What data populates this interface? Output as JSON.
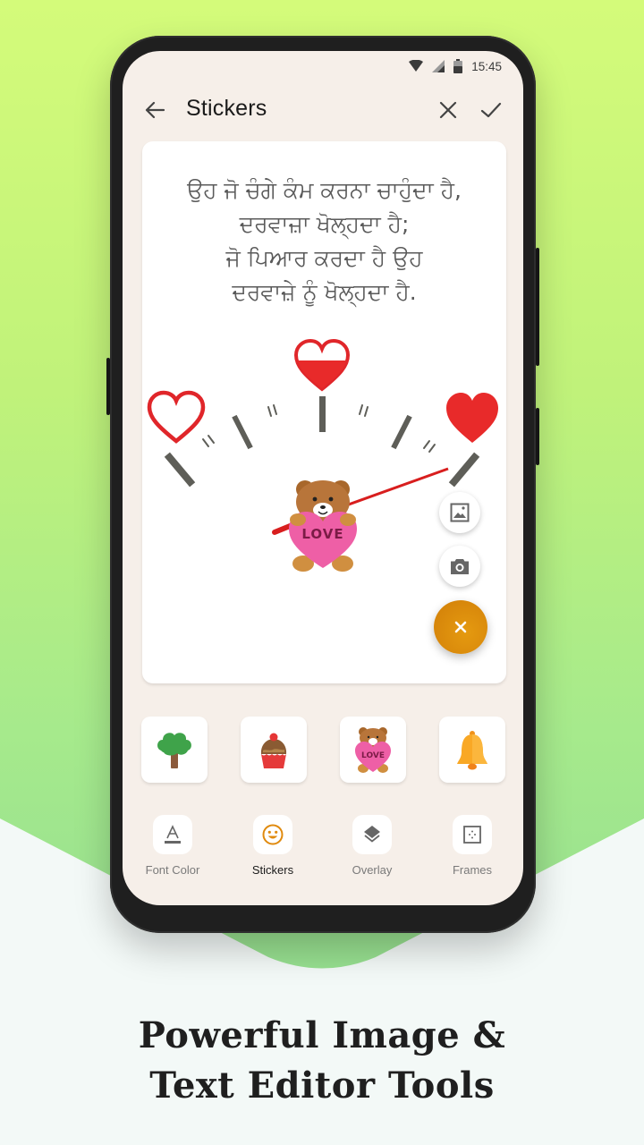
{
  "status_bar": {
    "time": "15:45",
    "icons": [
      "wifi-icon",
      "cell-signal-icon",
      "battery-icon"
    ]
  },
  "app_bar": {
    "title": "Stickers",
    "back_icon": "arrow-left-icon",
    "close_icon": "close-icon",
    "confirm_icon": "check-icon"
  },
  "canvas": {
    "quote_lines": [
      "ਉਹ ਜੋ ਚੰਗੇ ਕੰਮ ਕਰਨਾ ਚਾਹੁੰਦਾ ਹੈ,",
      "ਦਰਵਾਜ਼ਾ ਖੋਲ੍ਹਦਾ ਹੈ;",
      "ਜੋ ਪਿਆਰ ਕਰਦਾ ਹੈ ਉਹ",
      "ਦਰਵਾਜ਼ੇ ਨੂੰ ਖੋਲ੍ਹਦਾ ਹੈ."
    ],
    "gauge": {
      "levels": [
        "empty-heart",
        "half-heart",
        "full-heart"
      ],
      "needle_color": "#d81e1e",
      "heart_color": "#e82a2a"
    },
    "placed_sticker": {
      "name": "teddy-bear-love",
      "text": "LOVE"
    },
    "fab": {
      "gallery_icon": "image-icon",
      "camera_icon": "camera-icon",
      "main_icon": "close-icon",
      "main_color": "#dd8a0c"
    }
  },
  "sticker_tray": [
    {
      "name": "tree"
    },
    {
      "name": "cupcake"
    },
    {
      "name": "teddy-bear-love",
      "text": "LOVE"
    },
    {
      "name": "bell"
    }
  ],
  "tools": [
    {
      "label": "Font Color",
      "icon": "font-color-icon",
      "active": false
    },
    {
      "label": "Stickers",
      "icon": "smiley-icon",
      "active": true
    },
    {
      "label": "Overlay",
      "icon": "layers-icon",
      "active": false
    },
    {
      "label": "Frames",
      "icon": "frame-icon",
      "active": false
    }
  ],
  "accent_color": "#e08a0e",
  "tagline": {
    "line1": "Powerful Image &",
    "line2": "Text Editor Tools"
  }
}
